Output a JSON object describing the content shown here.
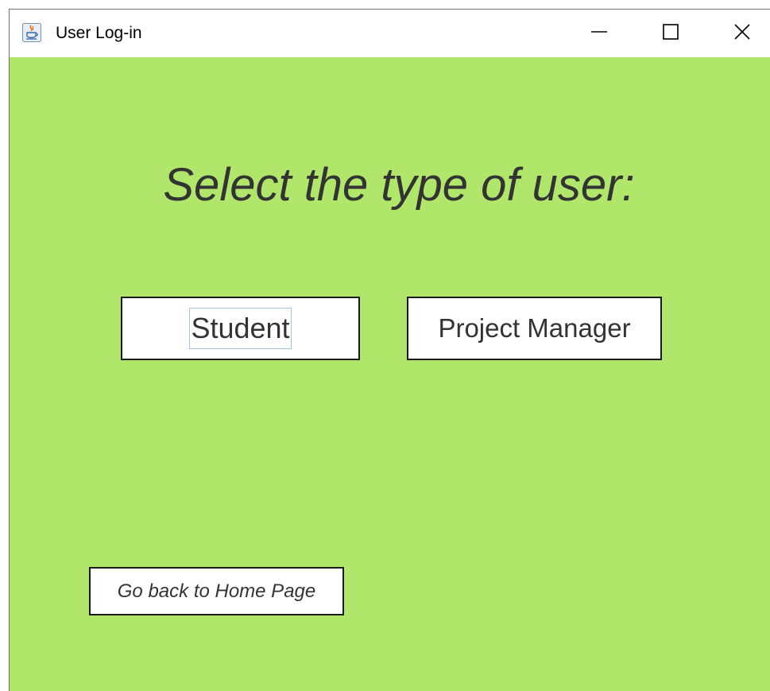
{
  "window": {
    "title": "User Log-in",
    "icon": "java-cup-icon",
    "controls": {
      "minimize": "minimize-icon",
      "maximize": "maximize-icon",
      "close": "close-icon"
    }
  },
  "content": {
    "prompt": "Select the type of user:",
    "buttons": {
      "student": "Student",
      "project_manager": "Project Manager",
      "home": "Go back to Home Page"
    }
  },
  "colors": {
    "background": "#b0e76b",
    "text": "#333333",
    "button_background": "#ffffff",
    "button_border": "#1a1a1a",
    "focus_ring": "#a8c4e0"
  }
}
